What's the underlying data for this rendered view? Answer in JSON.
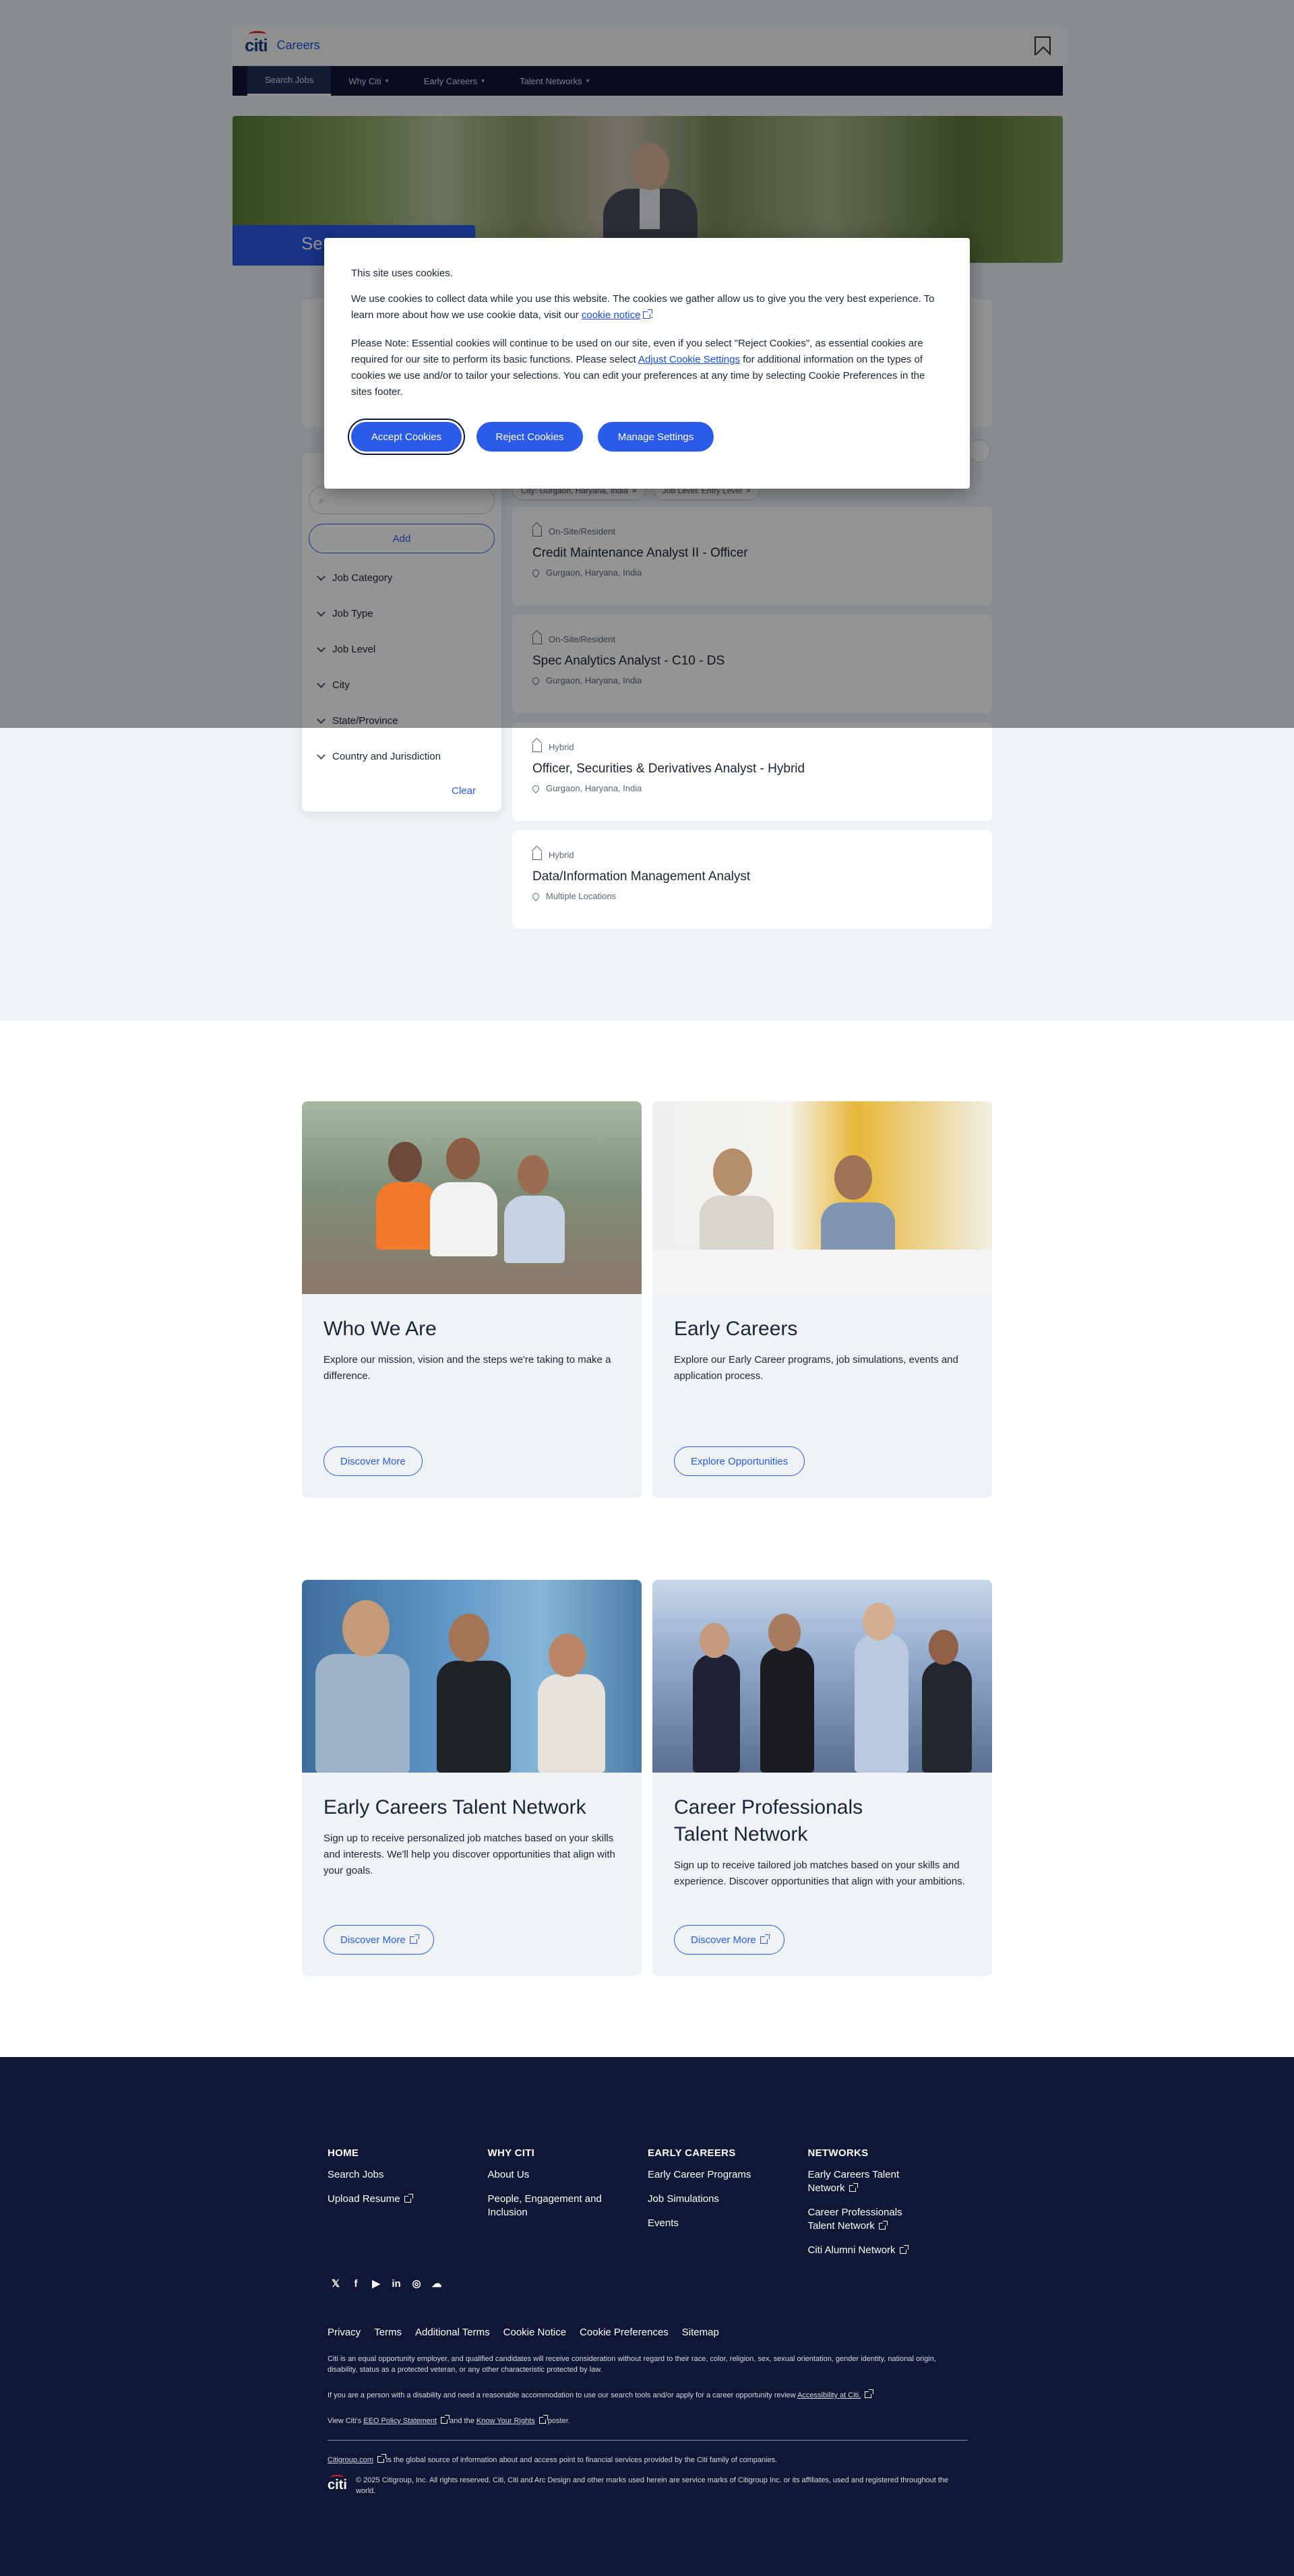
{
  "header": {
    "logo_text": "citi",
    "careers_link": "Careers"
  },
  "nav": {
    "items": [
      {
        "label": "Search Jobs",
        "has_menu": false
      },
      {
        "label": "Why Citi",
        "has_menu": true
      },
      {
        "label": "Early Careers",
        "has_menu": true
      },
      {
        "label": "Talent Networks",
        "has_menu": true
      }
    ]
  },
  "hero": {
    "button_label": "Se"
  },
  "cookie_banner": {
    "title": "This site uses cookies.",
    "p1_text": "We use cookies to collect data while you use this website. The cookies we gather allow us to give you the very best experience. To learn more about how we use cookie data, visit our ",
    "p1_link": "cookie notice",
    "p1_end": ".",
    "p2_text": "Please Note: Essential cookies will continue to be used on our site, even if you select \"Reject Cookies\", as essential cookies are required for our site to perform its basic functions. Please select ",
    "p2_link": "Adjust Cookie Settings",
    "p2_end": " for additional information on the types of cookies we use and/or to tailor your selections. You can edit your preferences at any time by selecting Cookie Preferences in the sites footer.",
    "accept_label": "Accept Cookies",
    "reject_label": "Reject Cookies",
    "manage_label": "Manage Settings"
  },
  "filters": {
    "add_label": "Add",
    "accordion": [
      "Job Category",
      "Job Type",
      "Job Level",
      "City",
      "State/Province",
      "Country and Jurisdiction"
    ],
    "clear_label": "Clear"
  },
  "chips": [
    "City: Gurgaon, Haryana, India",
    "Job Level: Entry Level"
  ],
  "jobs": [
    {
      "mode": "On-Site/Resident",
      "title": "Credit Maintenance Analyst II - Officer",
      "location": "Gurgaon, Haryana, India"
    },
    {
      "mode": "On-Site/Resident",
      "title": "Spec Analytics Analyst - C10 - DS",
      "location": "Gurgaon, Haryana, India"
    },
    {
      "mode": "Hybrid",
      "title": "Officer, Securities & Derivatives Analyst - Hybrid",
      "location": "Gurgaon, Haryana, India"
    },
    {
      "mode": "Hybrid",
      "title": "Data/Information Management Analyst",
      "location": "Multiple Locations"
    }
  ],
  "features": [
    {
      "title": "Who We Are",
      "desc": "Explore our mission, vision and the steps we're taking to make a difference.",
      "button": "Discover More",
      "external": false
    },
    {
      "title": "Early Careers",
      "desc": "Explore our Early Career programs, job simulations, events and application process.",
      "button": "Explore Opportunities",
      "external": false
    },
    {
      "title": "Early Careers Talent Network",
      "desc": "Sign up to receive personalized job matches based on your skills and interests. We'll help you discover opportunities that align with your goals.",
      "button": "Discover More",
      "external": true
    },
    {
      "title": "Career Professionals Talent Network",
      "desc": "Sign up to receive tailored job matches based on your skills and experience. Discover opportunities that align with your ambitions.",
      "button": "Discover More",
      "external": true
    }
  ],
  "footer": {
    "columns": [
      {
        "heading": "HOME",
        "links": [
          {
            "label": "Search Jobs",
            "ext": false
          },
          {
            "label": "Upload Resume",
            "ext": true
          }
        ]
      },
      {
        "heading": "WHY CITI",
        "links": [
          {
            "label": "About Us",
            "ext": false
          },
          {
            "label": "People, Engagement and Inclusion",
            "ext": false
          }
        ]
      },
      {
        "heading": "EARLY CAREERS",
        "links": [
          {
            "label": "Early Career Programs",
            "ext": false
          },
          {
            "label": "Job Simulations",
            "ext": false
          },
          {
            "label": "Events",
            "ext": false
          }
        ]
      },
      {
        "heading": "NETWORKS",
        "links": [
          {
            "label": "Early Careers Talent Network",
            "ext": true
          },
          {
            "label": "Career Professionals Talent Network",
            "ext": true
          },
          {
            "label": "Citi Alumni Network",
            "ext": true
          }
        ]
      }
    ],
    "social_icons": [
      "x-icon",
      "facebook-icon",
      "youtube-icon",
      "linkedin-icon",
      "instagram-icon",
      "glassdoor-icon"
    ],
    "legal_links": [
      "Privacy",
      "Terms",
      "Additional Terms",
      "Cookie Notice",
      "Cookie Preferences",
      "Sitemap"
    ],
    "eeo_text": "Citi is an equal opportunity employer, and qualified candidates will receive consideration without regard to their race, color, religion, sex, sexual orientation, gender identity, national origin, disability, status as a protected veteran, or any other characteristic protected by law.",
    "accessibility_text": "If you are a person with a disability and need a reasonable accommodation to use our search tools and/or apply for a career opportunity review ",
    "accessibility_link": "Accessibility at Citi.",
    "eeo_policy_pre": "View Citi's ",
    "eeo_policy_link": "EEO Policy Statement",
    "eeo_policy_mid": " and the ",
    "know_rights_link": "Know Your Rights",
    "eeo_policy_end": " poster.",
    "citigroup_link": "Citigroup.com",
    "citigroup_text": " is the global source of information about and access point to financial services provided by the Citi family of companies.",
    "copyright": "© 2025 Citigroup, Inc. All rights reserved. Citi, Citi and Arc Design and other marks used herein are service marks of Citigroup Inc. or its affiliates, used and registered throughout the world."
  },
  "colors": {
    "brand_blue": "#2b5be8",
    "nav_dark": "#0e1535",
    "footer_dark": "#101735",
    "light_bg": "#eef3f7",
    "arc_red": "#e4242b"
  }
}
